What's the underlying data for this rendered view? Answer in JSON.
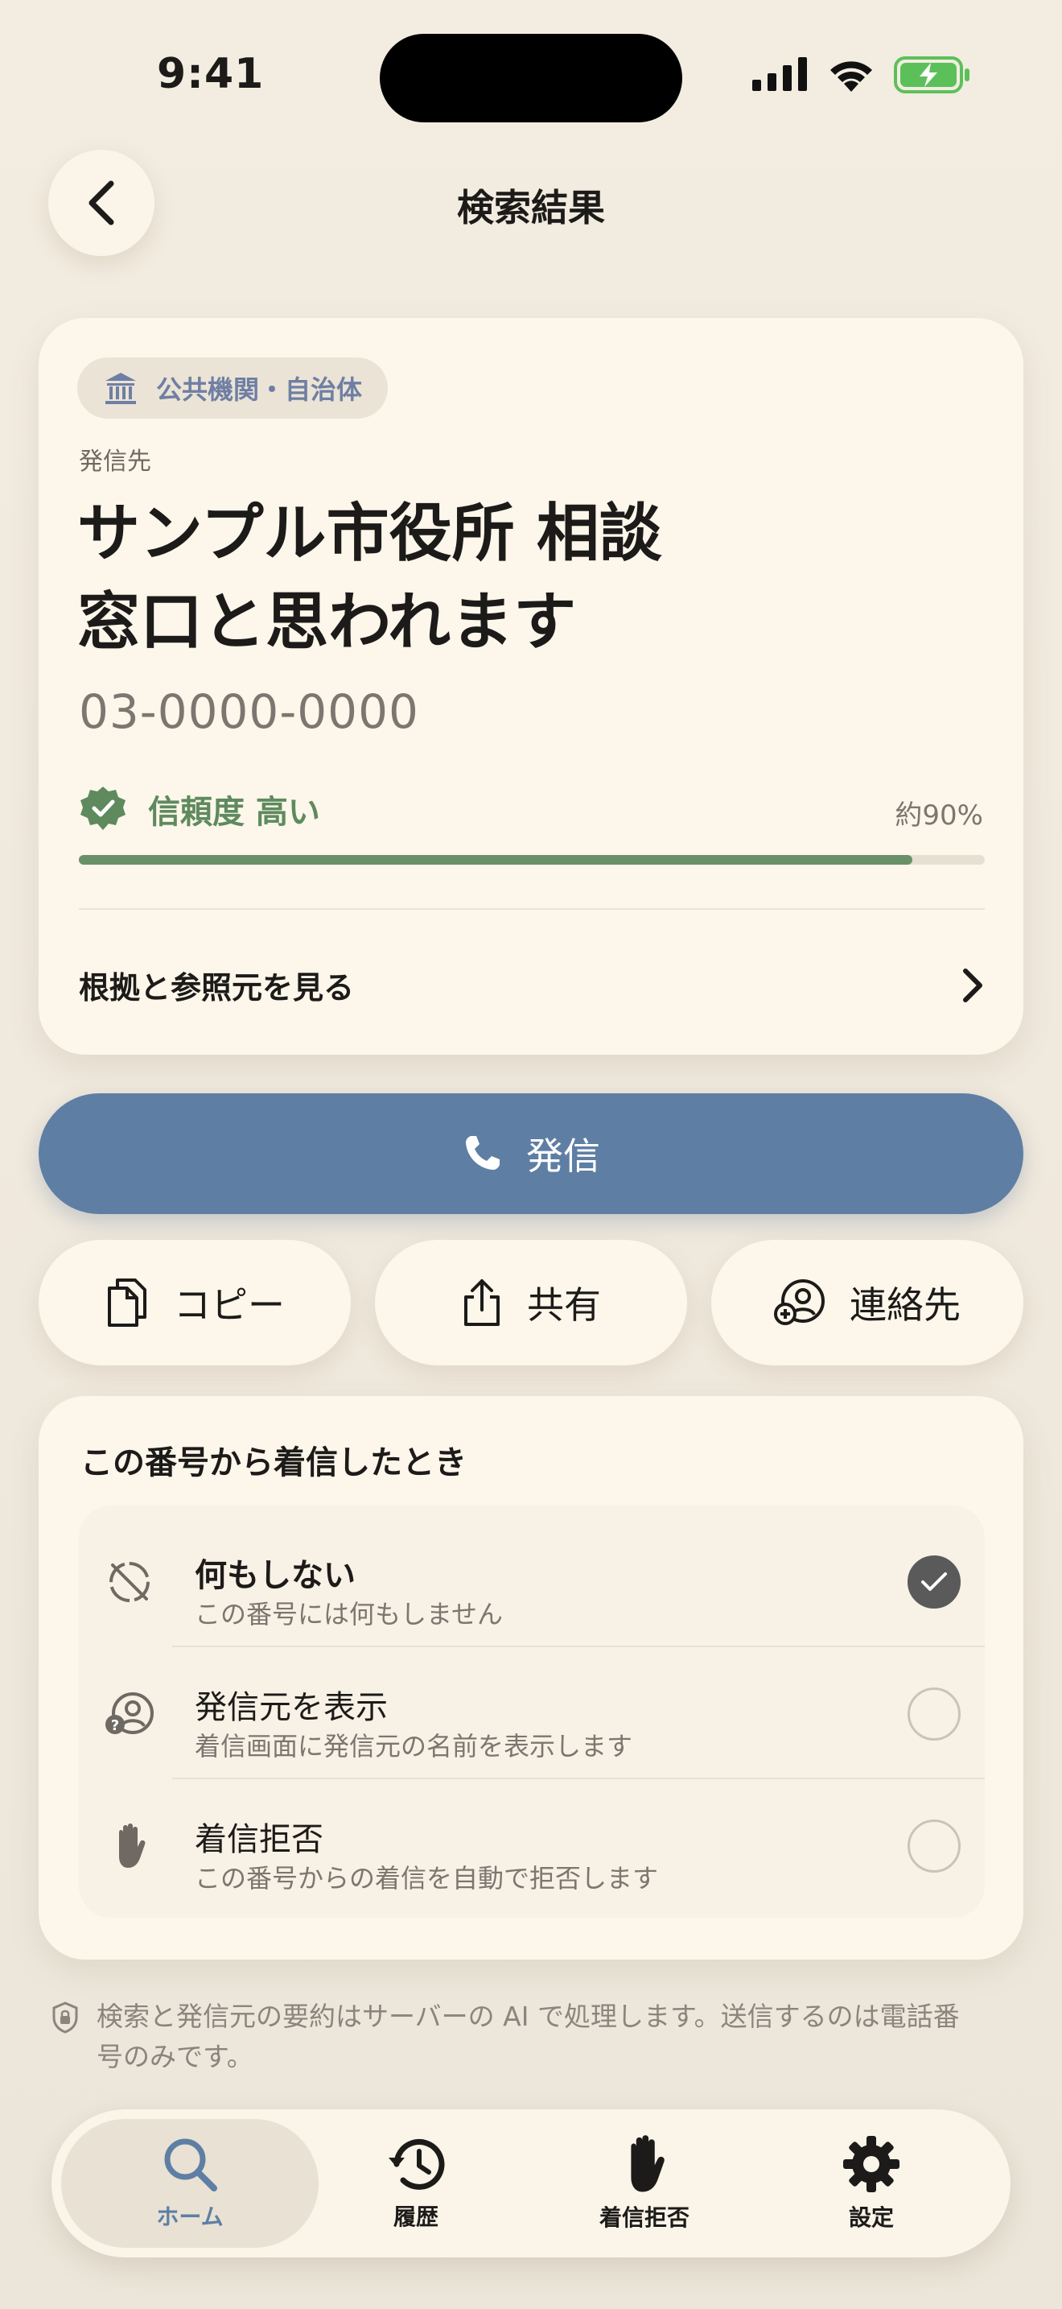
{
  "status_bar": {
    "time": "9:41"
  },
  "header": {
    "title": "検索結果"
  },
  "result": {
    "category": "公共機関・自治体",
    "caller_label": "発信先",
    "caller_name_line1": "サンプル市役所 相談",
    "caller_name_line2": "窓口と思われます",
    "phone_number": "03-0000-0000",
    "confidence_label": "信頼度 高い",
    "confidence_percent_text": "約90%",
    "confidence_value": 0.92,
    "evidence_link": "根拠と参照元を見る"
  },
  "actions": {
    "call": "発信",
    "copy": "コピー",
    "share": "共有",
    "contact": "連絡先"
  },
  "incoming": {
    "title": "この番号から着信したとき",
    "options": [
      {
        "title": "何もしない",
        "subtitle": "この番号には何もしません",
        "selected": true
      },
      {
        "title": "発信元を表示",
        "subtitle": "着信画面に発信元の名前を表示します",
        "selected": false
      },
      {
        "title": "着信拒否",
        "subtitle": "この番号からの着信を自動で拒否します",
        "selected": false
      }
    ]
  },
  "privacy_note": "検索と発信元の要約はサーバーの AI で処理します。送信するのは電話番号のみです。",
  "tabs": [
    {
      "label": "ホーム",
      "icon": "search-icon",
      "active": true
    },
    {
      "label": "履歴",
      "icon": "history-icon",
      "active": false
    },
    {
      "label": "着信拒否",
      "icon": "hand-icon",
      "active": false
    },
    {
      "label": "設定",
      "icon": "gear-icon",
      "active": false
    }
  ],
  "colors": {
    "accent": "#5e7fa3",
    "confidence": "#6a9069",
    "background": "#f3ece0"
  }
}
